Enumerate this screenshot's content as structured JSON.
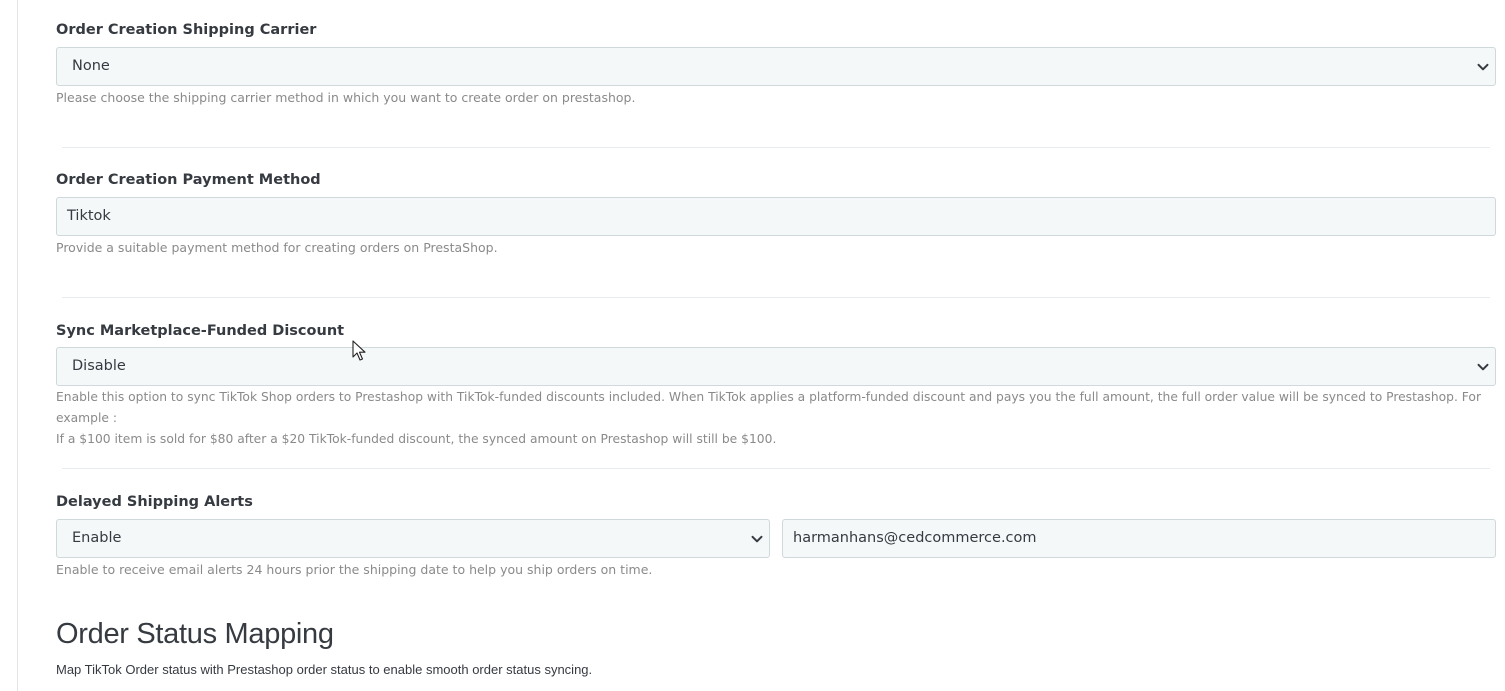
{
  "shipping_carrier": {
    "label": "Order Creation Shipping Carrier",
    "selected": "None",
    "help": "Please choose the shipping carrier method in which you want to create order on prestashop."
  },
  "payment_method": {
    "label": "Order Creation Payment Method",
    "value": "Tiktok",
    "help": "Provide a suitable payment method for creating orders on PrestaShop."
  },
  "marketplace_discount": {
    "label": "Sync Marketplace-Funded Discount",
    "selected": "Disable",
    "help_line1": "Enable this option to sync TikTok Shop orders to Prestashop with TikTok-funded discounts included. When TikTok applies a platform-funded discount and pays you the full amount, the full order value will be synced to Prestashop. For example :",
    "help_line2": "If a $100 item is sold for $80 after a $20 TikTok-funded discount, the synced amount on Prestashop will still be $100."
  },
  "delayed_shipping": {
    "label": "Delayed Shipping Alerts",
    "selected": "Enable",
    "email": "harmanhans@cedcommerce.com",
    "help": "Enable to receive email alerts 24 hours prior the shipping date to help you ship orders on time."
  },
  "order_status_mapping": {
    "title": "Order Status Mapping",
    "description": "Map TikTok Order status with Prestashop order status to enable smooth order status syncing."
  },
  "icons": {
    "select_arrow": "chevron-down-icon",
    "cursor": "mouse-pointer-icon"
  },
  "colors": {
    "field_bg": "#f5f8f9",
    "field_border": "#cfd8da",
    "help_text": "#8a8a8a",
    "label_text": "#363a41"
  }
}
